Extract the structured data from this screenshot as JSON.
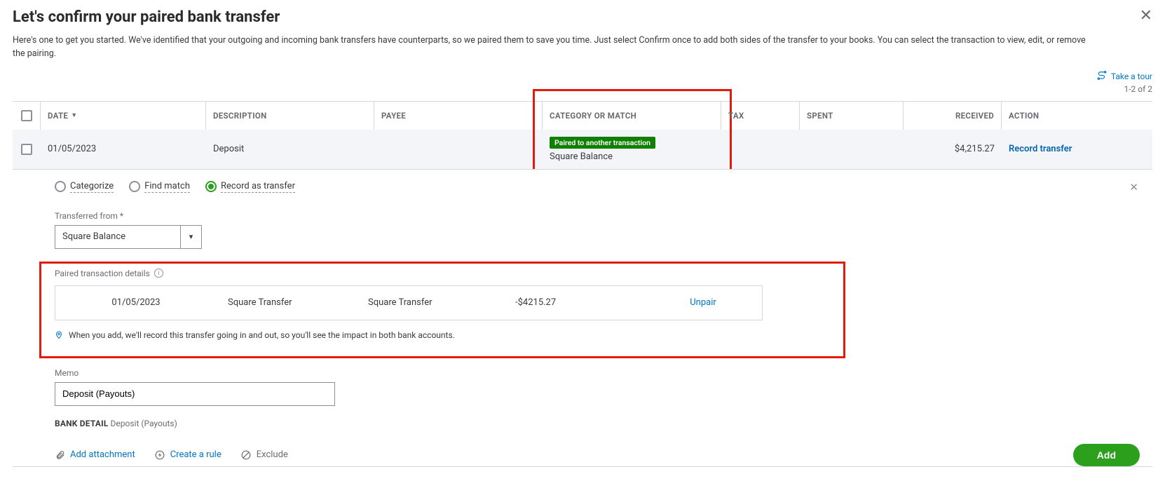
{
  "header": {
    "title": "Let's confirm your paired bank transfer",
    "subtitle": "Here's one to get you started. We've identified that your outgoing and incoming bank transfers have counterparts, so we paired them to save you time. Just select Confirm once to add both sides of the transfer to your books. You can select the transaction to view, edit, or remove the pairing."
  },
  "meta": {
    "tour_label": "Take a tour",
    "range": "1-2 of 2"
  },
  "columns": {
    "date": "DATE",
    "description": "DESCRIPTION",
    "payee": "PAYEE",
    "category": "CATEGORY OR MATCH",
    "tax": "TAX",
    "spent": "SPENT",
    "received": "RECEIVED",
    "action": "ACTION"
  },
  "row": {
    "date": "01/05/2023",
    "description": "Deposit",
    "payee": "",
    "badge": "Paired to another transaction",
    "category_sub": "Square Balance",
    "tax": "",
    "spent": "",
    "received": "$4,215.27",
    "action_label": "Record transfer"
  },
  "details": {
    "radio_categorize": "Categorize",
    "radio_find": "Find match",
    "radio_transfer": "Record as transfer",
    "transferred_from_label": "Transferred from *",
    "transferred_from_value": "Square Balance",
    "paired_section_label": "Paired transaction details",
    "paired": {
      "date": "01/05/2023",
      "description": "Square Transfer",
      "payee": "Square Transfer",
      "amount": "-$4215.27",
      "unpair_label": "Unpair"
    },
    "hint": "When you add, we'll record this transfer going in and out, so you'll see the impact in both bank accounts.",
    "memo_label": "Memo",
    "memo_value": "Deposit (Payouts)",
    "bank_detail_label": "BANK DETAIL",
    "bank_detail_value": "Deposit (Payouts)",
    "attach_label": "Add attachment",
    "rule_label": "Create a rule",
    "exclude_label": "Exclude",
    "add_label": "Add"
  }
}
